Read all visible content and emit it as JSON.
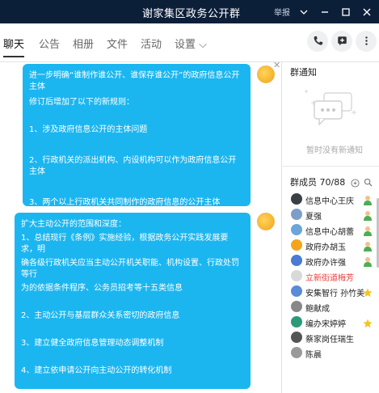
{
  "window": {
    "title": "谢家集区政务公开群",
    "report": "举报",
    "controls": [
      "chevron-down",
      "minimize",
      "maximize",
      "close"
    ]
  },
  "tabs": [
    {
      "label": "聊天",
      "active": true
    },
    {
      "label": "公告"
    },
    {
      "label": "相册"
    },
    {
      "label": "文件"
    },
    {
      "label": "活动"
    },
    {
      "label": "设置 ⌵"
    }
  ],
  "messages": [
    {
      "lines": [
        "进一步明确“谁制作谁公开、谁保存谁公开”的政府信息公开主体",
        "修订后增加了以下的新规则：",
        "",
        "1、涉及政府信息公开的主体问题",
        "",
        "2、行政机关的派出机构、内设机构可以作为政府信息公开主体",
        "",
        "3、两个以上行政机关共同制作的政府信息的公开主体"
      ]
    },
    {
      "lines": [
        "扩大主动公开的范围和深度：",
        "1、总结现行《条例》实施经验，根据政务公开实践发展要求，明",
        "确各级行政机关应当主动公开机关职能、机构设置、行政处罚等行",
        "为的依据条件程序、公务员招考等十五类信息",
        "",
        "2、主动公开与基层群众关系密切的政府信息",
        "",
        "3、建立健全政府信息管理动态调整机制",
        "",
        "4、建立依申请公开向主动公开的转化机制"
      ]
    }
  ],
  "sidebar": {
    "notice_title": "群通知",
    "notice_empty": "暂时没有新通知",
    "members_title": "群成员 70/88",
    "members": [
      {
        "name": "信息中心王庆",
        "color": "#3a3f47",
        "badge": "admin-icon"
      },
      {
        "name": "夏强",
        "color": "#7d9fc7",
        "badge": "admin-icon"
      },
      {
        "name": "信息中心胡蕾",
        "color": "#6aa6d8",
        "badge": "admin-icon"
      },
      {
        "name": "政府办胡玉",
        "color": "#f4a41a",
        "badge": "admin-icon"
      },
      {
        "name": "政府办许强",
        "color": "#4b7bd2",
        "badge": "admin-icon"
      },
      {
        "name": "立新街道梅芳",
        "color": "#d9d9d9",
        "red": true
      },
      {
        "name": "安集智行 孙竹美",
        "color": "#5a8bd8",
        "badge": "star-icon"
      },
      {
        "name": "鲍献成",
        "color": "#888",
        "badge": ""
      },
      {
        "name": "编办宋婷婷",
        "color": "#2a9a7a",
        "badge": "star-icon"
      },
      {
        "name": "蔡家岗任瑞生",
        "color": "#555",
        "badge": ""
      },
      {
        "name": "陈晨",
        "color": "#9a9a9a",
        "badge": ""
      }
    ]
  }
}
